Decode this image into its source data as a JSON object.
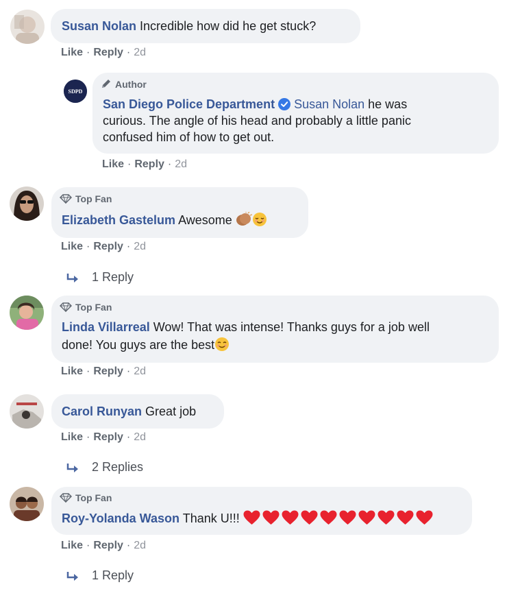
{
  "colors": {
    "name": "#385898",
    "bubble": "#f0f2f5",
    "meta": "#606770",
    "heart": "#e8222e"
  },
  "actions": {
    "like": "Like",
    "reply": "Reply",
    "sep": "·"
  },
  "comments": [
    {
      "author": "Susan Nolan",
      "lines": [
        "Incredible how did he get stuck?"
      ],
      "time": "2d"
    },
    {
      "badge": "Author",
      "author": "San Diego Police Department",
      "verified": true,
      "mention": "Susan Nolan",
      "lines": [
        "he was",
        "curious. The angle of his head and probably a little panic",
        "confused him of how to get out."
      ],
      "time": "2d",
      "avatar_text": "SDPD"
    },
    {
      "badge": "Top Fan",
      "author": "Elizabeth Gastelum",
      "lines": [
        "Awesome"
      ],
      "emojis": [
        "clapping-hands",
        "relieved-face"
      ],
      "time": "2d",
      "replies": "1 Reply"
    },
    {
      "badge": "Top Fan",
      "author": "Linda Villarreal",
      "lines": [
        "Wow! That was intense! Thanks guys for a job well",
        "done! You guys are the best"
      ],
      "emojis": [
        "smiling-face"
      ],
      "time": "2d"
    },
    {
      "author": "Carol Runyan",
      "lines": [
        "Great job"
      ],
      "time": "2d",
      "replies": "2 Replies"
    },
    {
      "badge": "Top Fan",
      "author": "Roy-Yolanda Wason",
      "lines": [
        "Thank U!!!"
      ],
      "heart_count": 10,
      "time": "2d",
      "replies": "1 Reply"
    }
  ]
}
